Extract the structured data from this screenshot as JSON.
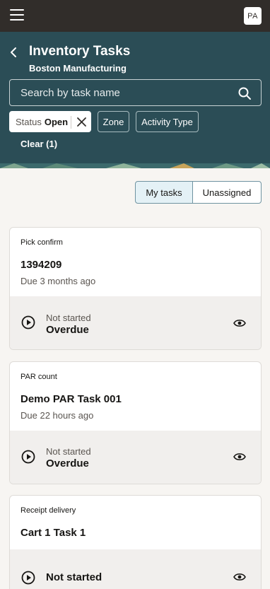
{
  "topbar": {
    "menu_icon": "hamburger-menu-icon",
    "avatar_initials": "PA"
  },
  "header": {
    "back_icon": "chevron-left-icon",
    "title": "Inventory Tasks",
    "subtitle": "Boston Manufacturing",
    "background_color": "#2b4d56"
  },
  "search": {
    "placeholder": "Search by task name",
    "value": "",
    "icon": "search-icon"
  },
  "filters": {
    "status_label": "Status",
    "status_value": "Open",
    "zone_label": "Zone",
    "activity_label": "Activity Type",
    "clear_label": "Clear (1)"
  },
  "view_toggle": {
    "my_tasks": "My tasks",
    "unassigned": "Unassigned",
    "selected": "My tasks"
  },
  "tasks": [
    {
      "type": "Pick confirm",
      "id": "1394209",
      "due": "Due 3 months ago",
      "status": "Not started",
      "flag": "Overdue"
    },
    {
      "type": "PAR count",
      "id": "Demo PAR Task 001",
      "due": "Due 22 hours ago",
      "status": "Not started",
      "flag": "Overdue"
    },
    {
      "type": "Receipt delivery",
      "id": "Cart 1 Task 1",
      "due": "",
      "status": "Not started",
      "flag": ""
    }
  ]
}
